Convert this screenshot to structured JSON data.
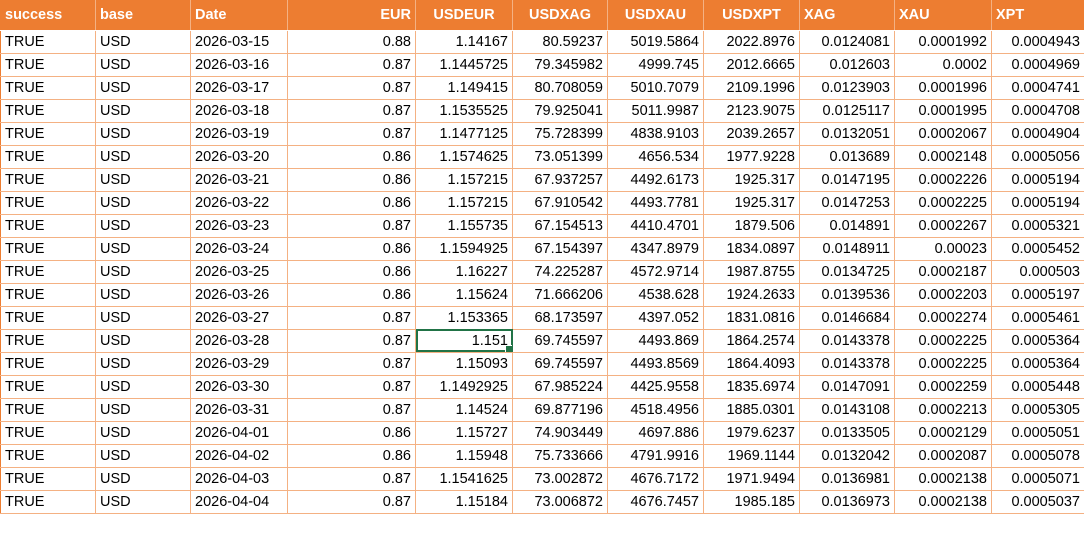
{
  "sheet": {
    "headers": [
      "success",
      "base",
      "Date",
      "EUR",
      "USDEUR",
      "USDXAG",
      "USDXAU",
      "USDXPT",
      "XAG",
      "XAU",
      "XPT"
    ],
    "rows": [
      [
        "TRUE",
        "USD",
        "2026-03-15",
        "0.88",
        "1.14167",
        "80.59237",
        "5019.5864",
        "2022.8976",
        "0.0124081",
        "0.0001992",
        "0.0004943"
      ],
      [
        "TRUE",
        "USD",
        "2026-03-16",
        "0.87",
        "1.1445725",
        "79.345982",
        "4999.745",
        "2012.6665",
        "0.012603",
        "0.0002",
        "0.0004969"
      ],
      [
        "TRUE",
        "USD",
        "2026-03-17",
        "0.87",
        "1.149415",
        "80.708059",
        "5010.7079",
        "2109.1996",
        "0.0123903",
        "0.0001996",
        "0.0004741"
      ],
      [
        "TRUE",
        "USD",
        "2026-03-18",
        "0.87",
        "1.1535525",
        "79.925041",
        "5011.9987",
        "2123.9075",
        "0.0125117",
        "0.0001995",
        "0.0004708"
      ],
      [
        "TRUE",
        "USD",
        "2026-03-19",
        "0.87",
        "1.1477125",
        "75.728399",
        "4838.9103",
        "2039.2657",
        "0.0132051",
        "0.0002067",
        "0.0004904"
      ],
      [
        "TRUE",
        "USD",
        "2026-03-20",
        "0.86",
        "1.1574625",
        "73.051399",
        "4656.534",
        "1977.9228",
        "0.013689",
        "0.0002148",
        "0.0005056"
      ],
      [
        "TRUE",
        "USD",
        "2026-03-21",
        "0.86",
        "1.157215",
        "67.937257",
        "4492.6173",
        "1925.317",
        "0.0147195",
        "0.0002226",
        "0.0005194"
      ],
      [
        "TRUE",
        "USD",
        "2026-03-22",
        "0.86",
        "1.157215",
        "67.910542",
        "4493.7781",
        "1925.317",
        "0.0147253",
        "0.0002225",
        "0.0005194"
      ],
      [
        "TRUE",
        "USD",
        "2026-03-23",
        "0.87",
        "1.155735",
        "67.154513",
        "4410.4701",
        "1879.506",
        "0.014891",
        "0.0002267",
        "0.0005321"
      ],
      [
        "TRUE",
        "USD",
        "2026-03-24",
        "0.86",
        "1.1594925",
        "67.154397",
        "4347.8979",
        "1834.0897",
        "0.0148911",
        "0.00023",
        "0.0005452"
      ],
      [
        "TRUE",
        "USD",
        "2026-03-25",
        "0.86",
        "1.16227",
        "74.225287",
        "4572.9714",
        "1987.8755",
        "0.0134725",
        "0.0002187",
        "0.000503"
      ],
      [
        "TRUE",
        "USD",
        "2026-03-26",
        "0.86",
        "1.15624",
        "71.666206",
        "4538.628",
        "1924.2633",
        "0.0139536",
        "0.0002203",
        "0.0005197"
      ],
      [
        "TRUE",
        "USD",
        "2026-03-27",
        "0.87",
        "1.153365",
        "68.173597",
        "4397.052",
        "1831.0816",
        "0.0146684",
        "0.0002274",
        "0.0005461"
      ],
      [
        "TRUE",
        "USD",
        "2026-03-28",
        "0.87",
        "1.151",
        "69.745597",
        "4493.869",
        "1864.2574",
        "0.0143378",
        "0.0002225",
        "0.0005364"
      ],
      [
        "TRUE",
        "USD",
        "2026-03-29",
        "0.87",
        "1.15093",
        "69.745597",
        "4493.8569",
        "1864.4093",
        "0.0143378",
        "0.0002225",
        "0.0005364"
      ],
      [
        "TRUE",
        "USD",
        "2026-03-30",
        "0.87",
        "1.1492925",
        "67.985224",
        "4425.9558",
        "1835.6974",
        "0.0147091",
        "0.0002259",
        "0.0005448"
      ],
      [
        "TRUE",
        "USD",
        "2026-03-31",
        "0.87",
        "1.14524",
        "69.877196",
        "4518.4956",
        "1885.0301",
        "0.0143108",
        "0.0002213",
        "0.0005305"
      ],
      [
        "TRUE",
        "USD",
        "2026-04-01",
        "0.86",
        "1.15727",
        "74.903449",
        "4697.886",
        "1979.6237",
        "0.0133505",
        "0.0002129",
        "0.0005051"
      ],
      [
        "TRUE",
        "USD",
        "2026-04-02",
        "0.86",
        "1.15948",
        "75.733666",
        "4791.9916",
        "1969.1144",
        "0.0132042",
        "0.0002087",
        "0.0005078"
      ],
      [
        "TRUE",
        "USD",
        "2026-04-03",
        "0.87",
        "1.1541625",
        "73.002872",
        "4676.7172",
        "1971.9494",
        "0.0136981",
        "0.0002138",
        "0.0005071"
      ],
      [
        "TRUE",
        "USD",
        "2026-04-04",
        "0.87",
        "1.15184",
        "73.006872",
        "4676.7457",
        "1985.185",
        "0.0136973",
        "0.0002138",
        "0.0005037"
      ]
    ],
    "selected_cell": {
      "row": 13,
      "col": 4
    },
    "colors": {
      "header_bg": "#ed7d31",
      "header_text": "#ffffff",
      "grid_line": "#f4b183",
      "selection": "#217346"
    }
  }
}
